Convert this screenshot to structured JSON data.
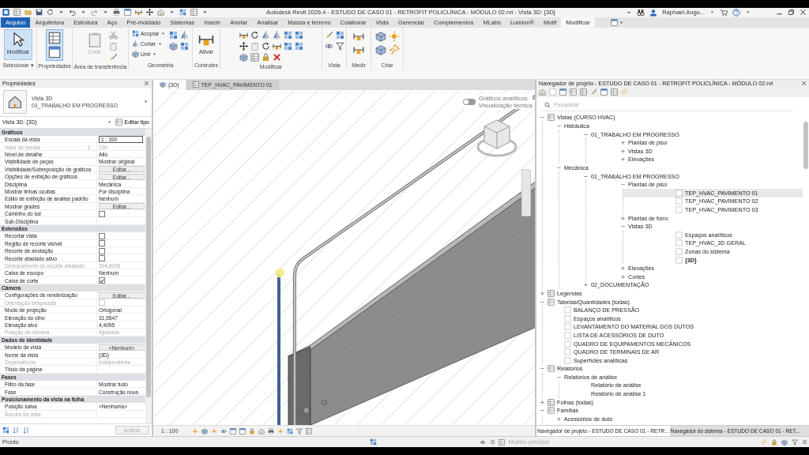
{
  "window": {
    "title": "Autodesk Revit 2026.4 - ESTUDO DE CASO 01 - RETROFIT POLICLÍNICA - MÓDULO 02.rvt - Vista 3D: {3D}",
    "user": "Raphael.Augu..."
  },
  "ribbon_tabs": [
    {
      "label": "Arquivo",
      "kind": "file",
      "selected": false
    },
    {
      "label": "Arquitetura",
      "kind": "tab",
      "selected": false
    },
    {
      "label": "Estrutura",
      "kind": "tab",
      "selected": false
    },
    {
      "label": "Aço",
      "kind": "tab",
      "selected": false
    },
    {
      "label": "Pré-moldado",
      "kind": "tab",
      "selected": false
    },
    {
      "label": "Sistemas",
      "kind": "tab",
      "selected": false
    },
    {
      "label": "Inserir",
      "kind": "tab",
      "selected": false
    },
    {
      "label": "Anotar",
      "kind": "tab",
      "selected": false
    },
    {
      "label": "Analisar",
      "kind": "tab",
      "selected": false
    },
    {
      "label": "Massa e terreno",
      "kind": "tab",
      "selected": false
    },
    {
      "label": "Colaborar",
      "kind": "tab",
      "selected": false
    },
    {
      "label": "Vista",
      "kind": "tab",
      "selected": false
    },
    {
      "label": "Gerenciar",
      "kind": "tab",
      "selected": false
    },
    {
      "label": "Complementos",
      "kind": "tab",
      "selected": false
    },
    {
      "label": "MLabs",
      "kind": "tab",
      "selected": false
    },
    {
      "label": "Lumion®",
      "kind": "tab",
      "selected": false
    },
    {
      "label": "Motif",
      "kind": "tab",
      "selected": false
    },
    {
      "label": "Modificar",
      "kind": "tab",
      "selected": true
    }
  ],
  "ribbon_panels": [
    {
      "label": "Selecionar ▾",
      "tools": [
        {
          "kind": "big",
          "label": "Modificar",
          "selected": true,
          "disabled": false
        }
      ]
    },
    {
      "label": "Propriedades",
      "tools": [
        {
          "kind": "toggle",
          "on": true
        }
      ]
    },
    {
      "label": "Área de transferência",
      "tools": [
        {
          "kind": "big",
          "label": "Colar",
          "selected": false,
          "disabled": true
        }
      ]
    },
    {
      "label": "Geometria",
      "tools": [
        {
          "kind": "small",
          "label": "Acoplar"
        },
        {
          "kind": "small",
          "label": "Cortar"
        },
        {
          "kind": "small",
          "label": "Unir"
        }
      ]
    },
    {
      "label": "Controles",
      "tools": [
        {
          "kind": "big",
          "label": "Ativar",
          "selected": false,
          "disabled": false
        }
      ]
    },
    {
      "label": "Modificar"
    },
    {
      "label": "Vista"
    },
    {
      "label": "Medir"
    },
    {
      "label": "Criar"
    }
  ],
  "properties": {
    "title": "Propriedades",
    "type_name": "Vista 3D",
    "type_detail": "01_TRABALHO EM PROGRESSO",
    "selector": "Vista 3D: {3D}",
    "edit_type": "Editar tipo",
    "apply": "Aplicar",
    "groups": [
      {
        "name": "Gráficos",
        "rows": [
          {
            "label": "Escala da vista",
            "kind": "input",
            "value": "1 : 100",
            "disabled": false
          },
          {
            "label": "Valor de escala",
            "suffix": "1:",
            "kind": "text",
            "value": "100",
            "disabled": true
          },
          {
            "label": "Nível de detalhe",
            "kind": "text",
            "value": "Alto",
            "disabled": false
          },
          {
            "label": "Visibilidade de peças",
            "kind": "text",
            "value": "Mostrar original",
            "disabled": false
          },
          {
            "label": "Visibilidade/Sobreposição de gráficos",
            "kind": "button",
            "value": "Editar...",
            "disabled": false
          },
          {
            "label": "Opções de exibição de gráficos",
            "kind": "button",
            "value": "Editar...",
            "disabled": false
          },
          {
            "label": "Disciplina",
            "kind": "text",
            "value": "Mecânica",
            "disabled": false
          },
          {
            "label": "Mostrar linhas ocultas",
            "kind": "text",
            "value": "Por disciplina",
            "disabled": false
          },
          {
            "label": "Estilo de exibição de análise padrão",
            "kind": "text",
            "value": "Nenhum",
            "disabled": false
          },
          {
            "label": "Mostrar grades",
            "kind": "button",
            "value": "Editar...",
            "disabled": false
          },
          {
            "label": "Caminho do sol",
            "kind": "checkbox",
            "checked": false,
            "disabled": false
          },
          {
            "label": "Sub-Disciplina",
            "kind": "text",
            "disabled": false
          }
        ]
      },
      {
        "name": "Extensões",
        "rows": [
          {
            "label": "Recortar vista",
            "kind": "checkbox",
            "checked": false,
            "disabled": false
          },
          {
            "label": "Região de recorte visível",
            "kind": "checkbox",
            "checked": false,
            "disabled": false
          },
          {
            "label": "Recorte de anotação",
            "kind": "checkbox",
            "checked": false,
            "disabled": false
          },
          {
            "label": "Recorte afastado ativo",
            "kind": "checkbox",
            "checked": false,
            "disabled": false
          },
          {
            "label": "Deslocamento do recorte afastado",
            "kind": "text",
            "value": "304,8000",
            "disabled": true
          },
          {
            "label": "Caixa de escopo",
            "kind": "text",
            "value": "Nenhum",
            "disabled": false
          },
          {
            "label": "Caixa de corte",
            "kind": "checkbox",
            "checked": true,
            "disabled": false
          }
        ]
      },
      {
        "name": "Câmera",
        "rows": [
          {
            "label": "Configurações de renderização",
            "kind": "button",
            "value": "Editar...",
            "disabled": false
          },
          {
            "label": "Orientação bloqueada",
            "kind": "checkbox",
            "checked": false,
            "disabled": true
          },
          {
            "label": "Modo de projeção",
            "kind": "text",
            "value": "Ortogonal",
            "disabled": false
          },
          {
            "label": "Elevação do olho",
            "kind": "text",
            "value": "31,6547",
            "disabled": false
          },
          {
            "label": "Elevação alvo",
            "kind": "text",
            "value": "4,4095",
            "disabled": false
          },
          {
            "label": "Posição da câmera",
            "kind": "text",
            "value": "Ajustada",
            "disabled": true
          }
        ]
      },
      {
        "name": "Dados de identidade",
        "rows": [
          {
            "label": "Modelo de vista",
            "kind": "button",
            "value": "<Nenhum>",
            "disabled": false
          },
          {
            "label": "Nome da vista",
            "kind": "text",
            "value": "{3D}",
            "disabled": false
          },
          {
            "label": "Dependência",
            "kind": "text",
            "value": "Independente",
            "disabled": true
          },
          {
            "label": "Título da página",
            "kind": "text",
            "disabled": false
          }
        ]
      },
      {
        "name": "Fases",
        "rows": [
          {
            "label": "Filtro da fase",
            "kind": "text",
            "value": "Mostrar tudo",
            "disabled": false
          },
          {
            "label": "Fase",
            "kind": "text",
            "value": "Construção nova",
            "disabled": false
          }
        ]
      },
      {
        "name": "Posicionamento da vista na folha",
        "rows": [
          {
            "label": "Posição salva",
            "kind": "text",
            "value": "<Nenhuma>",
            "disabled": false
          },
          {
            "label": "Âncora da vista",
            "kind": "text",
            "disabled": true
          }
        ]
      }
    ]
  },
  "view_tabs": [
    {
      "label": "{3D}",
      "selected": true
    },
    {
      "label": "TEP_HVAC_PAVIMENTO 01",
      "selected": false
    }
  ],
  "viewport": {
    "toggle": {
      "on": false,
      "labels": [
        "Gráficos analíticos",
        "Visualização técnica"
      ]
    },
    "scale": "1 : 100"
  },
  "browser": {
    "title": "Navegador de projeto - ESTUDO DE CASO 01 - RETROFIT POLICLÍNICA - MÓDULO 02.rvt",
    "search": {
      "placeholder": "Pesquisar"
    },
    "tree": [
      {
        "label": "Vistas (CURSO HVAC)",
        "kind": "category",
        "expanded": true,
        "selected": false,
        "children": [
          {
            "label": "Hidráulica",
            "kind": "folder",
            "expanded": true,
            "selected": false,
            "children": [
              {
                "label": "01_TRABALHO EM PROGRESSO",
                "kind": "folder",
                "expanded": true,
                "selected": false,
                "children": [
                  {
                    "label": "Plantas de piso",
                    "kind": "folder",
                    "expanded": false,
                    "selected": false
                  },
                  {
                    "label": "Vistas 3D",
                    "kind": "folder",
                    "expanded": false,
                    "selected": false
                  },
                  {
                    "label": "Elevações",
                    "kind": "folder",
                    "expanded": false,
                    "selected": false
                  }
                ]
              }
            ]
          },
          {
            "label": "Mecânica",
            "kind": "folder",
            "expanded": true,
            "selected": false,
            "children": [
              {
                "label": "01_TRABALHO EM PROGRESSO",
                "kind": "folder",
                "expanded": true,
                "selected": false,
                "children": [
                  {
                    "label": "Plantas de piso",
                    "kind": "folder",
                    "expanded": true,
                    "selected": false,
                    "children": [
                      {
                        "label": "TEP_HVAC_PAVIMENTO 01",
                        "kind": "view",
                        "selected": true,
                        "current": false
                      },
                      {
                        "label": "TEP_HVAC_PAVIMENTO 02",
                        "kind": "view",
                        "selected": false,
                        "current": false
                      },
                      {
                        "label": "TEP_HVAC_PAVIMENTO 03",
                        "kind": "view",
                        "selected": false,
                        "current": false
                      }
                    ]
                  },
                  {
                    "label": "Plantas de forro",
                    "kind": "folder",
                    "expanded": false,
                    "selected": false
                  },
                  {
                    "label": "Vistas 3D",
                    "kind": "folder",
                    "expanded": true,
                    "selected": false,
                    "children": [
                      {
                        "label": "Espaços analíticos",
                        "kind": "view",
                        "selected": false,
                        "current": false
                      },
                      {
                        "label": "TEP_HVAC_3D GERAL",
                        "kind": "view",
                        "selected": false,
                        "current": false
                      },
                      {
                        "label": "Zonas do sistema",
                        "kind": "view",
                        "selected": false,
                        "current": false
                      },
                      {
                        "label": "{3D}",
                        "kind": "view",
                        "selected": false,
                        "current": true
                      }
                    ]
                  },
                  {
                    "label": "Elevações",
                    "kind": "folder",
                    "expanded": false,
                    "selected": false
                  },
                  {
                    "label": "Cortes",
                    "kind": "folder",
                    "expanded": false,
                    "selected": false
                  }
                ]
              },
              {
                "label": "02_DOCUMENTAÇÃO",
                "kind": "folder",
                "expanded": false,
                "selected": false
              }
            ]
          }
        ]
      },
      {
        "label": "Legendas",
        "kind": "category",
        "expanded": false,
        "selected": false
      },
      {
        "label": "Tabelas/Quantidades (todas)",
        "kind": "category",
        "expanded": true,
        "selected": false,
        "children": [
          {
            "label": "BALANÇO DE PRESSÃO",
            "kind": "view",
            "selected": false,
            "current": false
          },
          {
            "label": "Espaços analíticos",
            "kind": "view",
            "selected": false,
            "current": false
          },
          {
            "label": "LEVANTAMENTO DO MATERIAL DOS DUTOS",
            "kind": "view",
            "selected": false,
            "current": false
          },
          {
            "label": "LISTA DE ACESSÓRIOS DE DUTO",
            "kind": "view",
            "selected": false,
            "current": false
          },
          {
            "label": "QUADRO DE EQUIPAMENTOS MECÂNICOS",
            "kind": "view",
            "selected": false,
            "current": false
          },
          {
            "label": "QUADRO DE TERMINAIS DE AR",
            "kind": "view",
            "selected": false,
            "current": false
          },
          {
            "label": "Superfícies analíticas",
            "kind": "view",
            "selected": false,
            "current": false
          }
        ]
      },
      {
        "label": "Relatórios",
        "kind": "category",
        "expanded": true,
        "selected": false,
        "children": [
          {
            "label": "Relatórios de análise",
            "kind": "folder",
            "expanded": true,
            "selected": false,
            "children": [
              {
                "label": "Relatório de análise",
                "kind": "item",
                "selected": false
              },
              {
                "label": "Relatório de análise 1",
                "kind": "item",
                "selected": false
              }
            ]
          }
        ]
      },
      {
        "label": "Folhas (todas)",
        "kind": "category",
        "expanded": false,
        "selected": false
      },
      {
        "label": "Famílias",
        "kind": "category",
        "expanded": true,
        "selected": false,
        "children": [
          {
            "label": "Acessórios de duto",
            "kind": "folder",
            "expanded": false,
            "selected": false
          }
        ]
      }
    ],
    "bottom_tabs": [
      {
        "label": "Navegador de projeto - ESTUDO DE CASO 01 - RETR...",
        "selected": true
      },
      {
        "label": "Navegador do sistema - ESTUDO DE CASO 01 - RET...",
        "selected": false
      }
    ]
  },
  "status_bar": {
    "message": "Pronto",
    "model": "Modelo principal",
    "counts": [
      ":0",
      ":0"
    ]
  }
}
